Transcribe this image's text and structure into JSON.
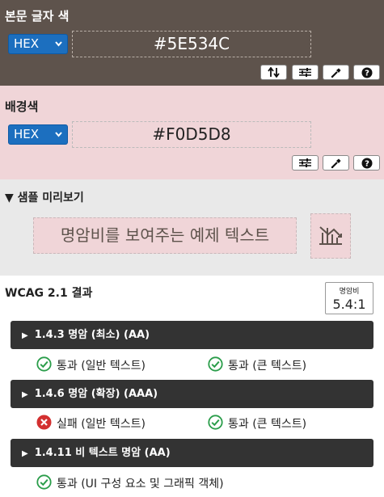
{
  "foreground": {
    "title": "본문 글자 색",
    "format": "HEX",
    "value": "#5E534C",
    "color": "#5e534c",
    "tools": [
      "swap-icon",
      "sliders-icon",
      "eyedropper-icon",
      "help-icon"
    ]
  },
  "background": {
    "title": "배경색",
    "format": "HEX",
    "value": "#F0D5D8",
    "color": "#f0d5d8",
    "tools": [
      "sliders-icon",
      "eyedropper-icon",
      "help-icon"
    ]
  },
  "preview": {
    "title": "▼ 샘플 미리보기",
    "sample_text": "명암비를 보여주는 예제 텍스트",
    "chart_icon": "chart-icon"
  },
  "wcag": {
    "title": "WCAG 2.1 결과",
    "ratio_label": "명암비",
    "ratio_value": "5.4:1",
    "criteria": [
      {
        "label": "1.4.3 명암 (최소) (AA)",
        "results": [
          {
            "status": "pass",
            "text": "통과 (일반 텍스트)"
          },
          {
            "status": "pass",
            "text": "통과 (큰 텍스트)"
          }
        ]
      },
      {
        "label": "1.4.6 명암 (확장) (AAA)",
        "results": [
          {
            "status": "fail",
            "text": "실패 (일반 텍스트)"
          },
          {
            "status": "pass",
            "text": "통과 (큰 텍스트)"
          }
        ]
      },
      {
        "label": "1.4.11 비 텍스트 명암 (AA)",
        "results": [
          {
            "status": "pass",
            "text": "통과 (UI 구성 요소 및 그래픽 객체)"
          }
        ]
      }
    ]
  },
  "colors": {
    "pass": "#2a9d4a",
    "fail": "#d33030",
    "bar": "#333333"
  }
}
